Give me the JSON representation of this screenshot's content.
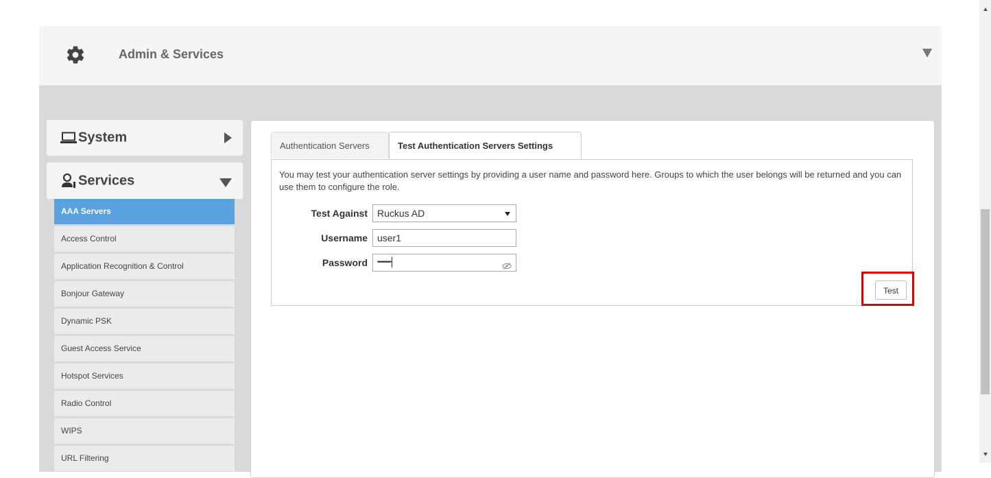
{
  "header": {
    "title": "Admin & Services"
  },
  "sidebar": {
    "system_label": "System",
    "services_label": "Services",
    "items": [
      {
        "label": "AAA Servers",
        "active": true
      },
      {
        "label": "Access Control"
      },
      {
        "label": "Application Recognition & Control"
      },
      {
        "label": "Bonjour Gateway"
      },
      {
        "label": "Dynamic PSK"
      },
      {
        "label": "Guest Access Service"
      },
      {
        "label": "Hotspot Services"
      },
      {
        "label": "Radio Control"
      },
      {
        "label": "WIPS"
      },
      {
        "label": "URL Filtering"
      }
    ]
  },
  "main": {
    "tabs": [
      {
        "label": "Authentication Servers"
      },
      {
        "label": "Test Authentication Servers Settings",
        "active": true
      }
    ],
    "description": "You may test your authentication server settings by providing a user name and password here. Groups to which the user belongs will be returned and you can use them to configure the role.",
    "form": {
      "test_against_label": "Test Against",
      "test_against_value": "Ruckus AD",
      "username_label": "Username",
      "username_value": "user1",
      "password_label": "Password",
      "password_masked": "••••••••"
    },
    "test_button": "Test"
  },
  "colors": {
    "active_item": "#5aa2de",
    "highlight": "#e00000"
  }
}
